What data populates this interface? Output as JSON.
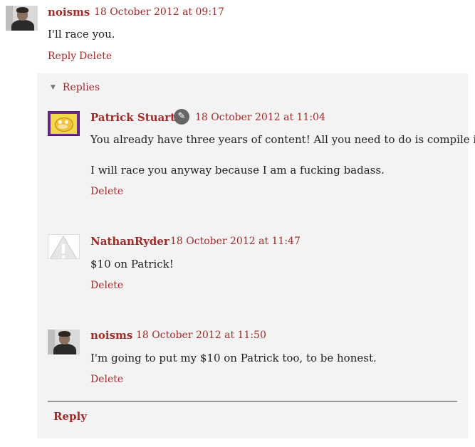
{
  "top_comment": {
    "author": "noisms",
    "timestamp": "18 October 2012 at 09:17",
    "text": "I'll race you.",
    "actions": {
      "reply": "Reply",
      "delete": "Delete"
    },
    "avatar": "photo"
  },
  "thread": {
    "toggle_label": "Replies",
    "replies": [
      {
        "author": "Patrick Stuart",
        "timestamp": "18 October 2012 at 11:04",
        "paragraphs": [
          "You already have three years of content! All you need to do is compile it.",
          "I will race you anyway because I am a fucking badass."
        ],
        "delete_label": "Delete",
        "avatar": "pokemon-card",
        "badge_icon": "pencil-icon"
      },
      {
        "author": "NathanRyder",
        "timestamp": "18 October 2012 at 11:47",
        "paragraphs": [
          "$10 on Patrick!"
        ],
        "delete_label": "Delete",
        "avatar": "warning-icon"
      },
      {
        "author": "noisms",
        "timestamp": "18 October 2012 at 11:50",
        "paragraphs": [
          "I'm going to put my $10 on Patrick too, to be honest."
        ],
        "delete_label": "Delete",
        "avatar": "photo"
      }
    ],
    "reply_label": "Reply"
  },
  "colors": {
    "link": "#a12b2b",
    "thread_background": "#f3f3f3",
    "text": "#222222"
  }
}
